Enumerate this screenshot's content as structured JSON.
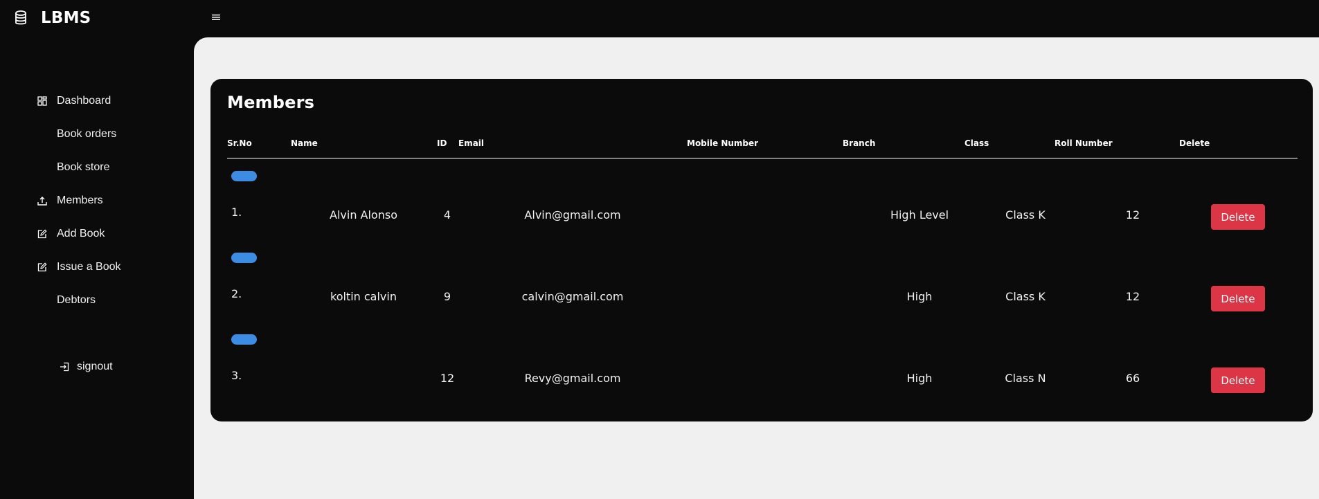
{
  "app": {
    "brand": "LBMS",
    "brand_icon": "database-icon",
    "menu_icon": "hamburger-menu-icon"
  },
  "sidebar": {
    "items": [
      {
        "label": "Dashboard",
        "icon": "dashboard-grid-icon"
      },
      {
        "label": "Book orders",
        "icon": ""
      },
      {
        "label": "Book store",
        "icon": ""
      },
      {
        "label": "Members",
        "icon": "upload-icon"
      },
      {
        "label": "Add Book",
        "icon": "edit-icon"
      },
      {
        "label": "Issue a Book",
        "icon": "edit-icon"
      },
      {
        "label": "Debtors",
        "icon": ""
      }
    ],
    "signout": {
      "label": "signout",
      "icon": "sign-in-icon"
    }
  },
  "members": {
    "title": "Members",
    "columns": [
      "Sr.No",
      "Name",
      "ID",
      "Email",
      "Mobile Number",
      "Branch",
      "Class",
      "Roll Number",
      "Delete"
    ],
    "rows": [
      {
        "srno": "1.",
        "name": "Alvin Alonso",
        "id": "4",
        "email": "Alvin@gmail.com",
        "mobile": "",
        "branch": "High Level",
        "class": "Class K",
        "roll": "12",
        "delete": "Delete"
      },
      {
        "srno": "2.",
        "name": "koltin calvin",
        "id": "9",
        "email": "calvin@gmail.com",
        "mobile": "",
        "branch": "High",
        "class": "Class K",
        "roll": "12",
        "delete": "Delete"
      },
      {
        "srno": "3.",
        "name": "",
        "id": "12",
        "email": "Revy@gmail.com",
        "mobile": "",
        "branch": "High",
        "class": "Class N",
        "roll": "66",
        "delete": "Delete"
      }
    ]
  },
  "colors": {
    "background": "#0c0b0c",
    "content": "#f0f0f0",
    "accent_pill": "#3d8ce3",
    "delete": "#dc3545"
  }
}
